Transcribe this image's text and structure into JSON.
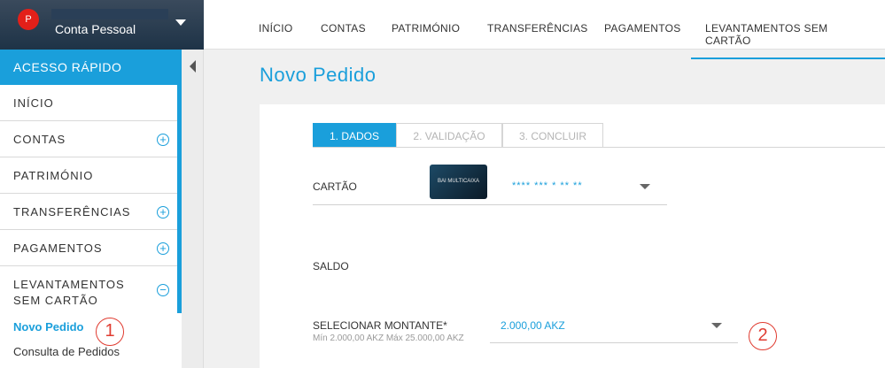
{
  "account": {
    "avatar_letter": "P",
    "name": "Conta Pessoal"
  },
  "sidebar": {
    "header": "ACESSO RÁPIDO",
    "items": [
      {
        "label": "INÍCIO",
        "expandable": false
      },
      {
        "label": "CONTAS",
        "expandable": true,
        "icon": "plus"
      },
      {
        "label": "PATRIMÓNIO",
        "expandable": false
      },
      {
        "label": "TRANSFERÊNCIAS",
        "expandable": true,
        "icon": "plus"
      },
      {
        "label": "PAGAMENTOS",
        "expandable": true,
        "icon": "plus"
      },
      {
        "label": "LEVANTAMENTOS SEM CARTÃO",
        "expandable": true,
        "icon": "minus"
      }
    ],
    "subitems": [
      {
        "label": "Novo Pedido",
        "active": true
      },
      {
        "label": "Consulta de Pedidos",
        "active": false
      }
    ]
  },
  "topnav": {
    "tabs": [
      "INÍCIO",
      "CONTAS",
      "PATRIMÓNIO",
      "TRANSFERÊNCIAS",
      "PAGAMENTOS",
      "LEVANTAMENTOS SEM CARTÃO"
    ],
    "active": "LEVANTAMENTOS SEM CARTÃO"
  },
  "page": {
    "title": "Novo Pedido"
  },
  "steps": [
    {
      "label": "1. DADOS",
      "active": true
    },
    {
      "label": "2. VALIDAÇÃO",
      "active": false
    },
    {
      "label": "3. CONCLUIR",
      "active": false
    }
  ],
  "form": {
    "card_label": "CARTÃO",
    "card_image_text": "BAI MULTICAIXA",
    "card_number": "**** *** * ** **",
    "saldo_label": "SALDO",
    "amount_label": "SELECIONAR MONTANTE*",
    "amount_hint": "Mín 2.000,00 AKZ Máx 25.000,00 AKZ",
    "amount_value": "2.000,00 AKZ"
  },
  "annotations": [
    "1",
    "2"
  ],
  "colors": {
    "accent": "#1a9fdb",
    "annotation": "#e03c31",
    "avatar": "#e32019"
  }
}
